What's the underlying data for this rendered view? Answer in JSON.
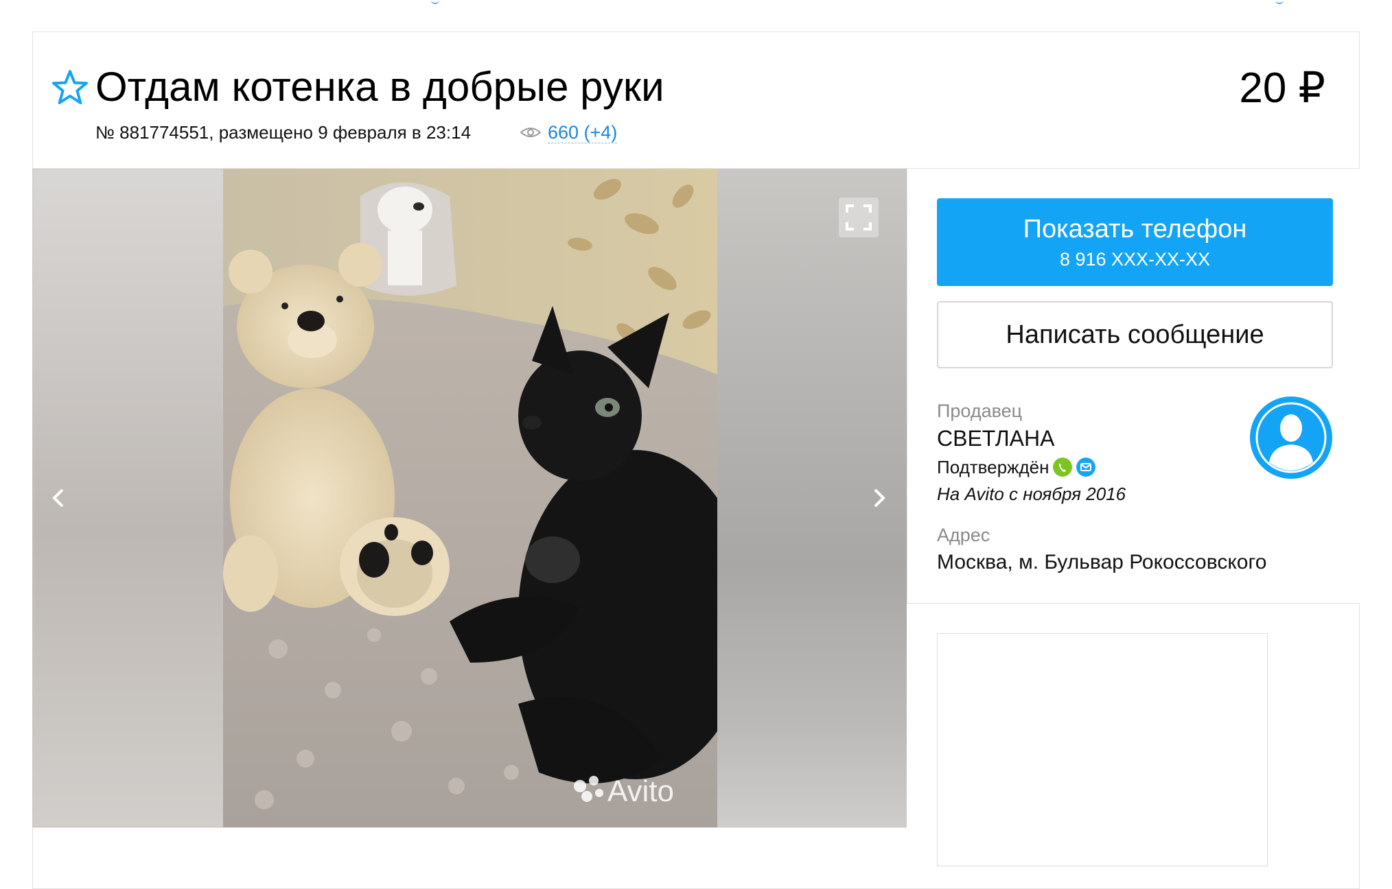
{
  "listing": {
    "title": "Отдам котенка в добрые руки",
    "price": "20 ₽",
    "meta": "№ 881774551, размещено 9 февраля в 23:14",
    "views": "660 (+4)"
  },
  "gallery": {
    "watermark": "Avito"
  },
  "contact": {
    "show_phone_label": "Показать телефон",
    "phone_masked": "8 916 XXX-XX-XX",
    "message_label": "Написать сообщение"
  },
  "seller": {
    "heading": "Продавец",
    "name": "СВЕТЛАНА",
    "verified_label": "Подтверждён",
    "since": "На Avito с ноября 2016"
  },
  "address": {
    "heading": "Адрес",
    "value": "Москва, м. Бульвар Рокоссовского"
  },
  "colors": {
    "accent": "#14a4f5",
    "link": "#1a86d9",
    "verified_phone": "#7cc420",
    "verified_mail": "#14a4f5"
  },
  "icons": [
    "star-icon",
    "eye-icon",
    "fullscreen-icon",
    "chevron-left-icon",
    "chevron-right-icon",
    "phone-verified-icon",
    "mail-verified-icon",
    "avatar-icon"
  ]
}
